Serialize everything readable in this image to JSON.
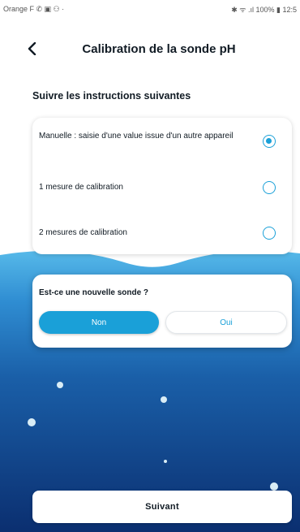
{
  "status_bar": {
    "left": "Orange F ✆ ▣ ⚇ ·",
    "right": "✱ ᯤ .ıl 100% ▮ 12:5"
  },
  "header": {
    "back_icon": "chevron-left-icon",
    "title": "Calibration de la sonde pH"
  },
  "instructions_title": "Suivre les instructions suivantes",
  "options": [
    {
      "label": "Manuelle : saisie d'une value issue d'un autre appareil",
      "selected": true
    },
    {
      "label": "1 mesure de calibration",
      "selected": false
    },
    {
      "label": "2 mesures de calibration",
      "selected": false
    }
  ],
  "question": {
    "label": "Est-ce une nouvelle sonde ?",
    "no_label": "Non",
    "yes_label": "Oui",
    "selected": "Non"
  },
  "next_button": "Suivant",
  "colors": {
    "accent": "#1aa0d8",
    "wave_top": "#4fb4e6",
    "wave_bottom": "#0b2f70",
    "text": "#111b24"
  }
}
